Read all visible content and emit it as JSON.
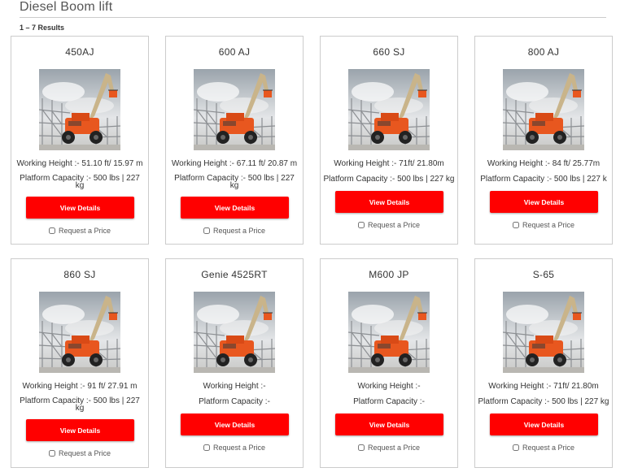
{
  "page": {
    "title": "Diesel Boom lift",
    "results": "1 – 7 Results"
  },
  "products": [
    {
      "name": "450AJ",
      "working_height": "Working Height :- 51.10 ft/ 15.97 m",
      "platform_line1": "Platform Capacity :- 500 lbs | 227",
      "platform_line2": "kg",
      "button": "View Details",
      "request": "Request a Price"
    },
    {
      "name": "600 AJ",
      "working_height": "Working Height :- 67.11 ft/ 20.87 m",
      "platform_line1": "Platform Capacity :- 500 lbs | 227",
      "platform_line2": "kg",
      "button": "View Details",
      "request": "Request a Price"
    },
    {
      "name": "660 SJ",
      "working_height": "Working Height :- 71ft/ 21.80m",
      "platform_line1": "Platform Capacity :- 500 lbs | 227 kg",
      "button": "View Details",
      "request": "Request a Price"
    },
    {
      "name": "800 AJ",
      "working_height": "Working Height :- 84 ft/ 25.77m",
      "platform_line1": "Platform Capacity :- 500 lbs | 227 k",
      "button": "View Details",
      "request": "Request a Price"
    },
    {
      "name": "860 SJ",
      "working_height": "Working Height :- 91 ft/ 27.91 m",
      "platform_line1": "Platform Capacity :- 500 lbs | 227",
      "platform_line2": "kg",
      "button": "View Details",
      "request": "Request a Price"
    },
    {
      "name": "Genie 4525RT",
      "working_height": "Working Height :-",
      "platform_line1": "Platform Capacity :-",
      "button": "View Details",
      "request": "Request a Price"
    },
    {
      "name": "M600 JP",
      "working_height": "Working Height :-",
      "platform_line1": "Platform Capacity :-",
      "button": "View Details",
      "request": "Request a Price"
    },
    {
      "name": "S-65",
      "working_height": "Working Height :- 71ft/ 21.80m",
      "platform_line1": "Platform Capacity :- 500 lbs | 227 kg",
      "button": "View Details",
      "request": "Request a Price"
    }
  ],
  "colors": {
    "button": "#ff0000",
    "border": "#cccccc",
    "machine": "#e8571f",
    "boom": "#c9b48a"
  },
  "icons": {
    "product_image": "diesel-boom-lift-photo"
  }
}
